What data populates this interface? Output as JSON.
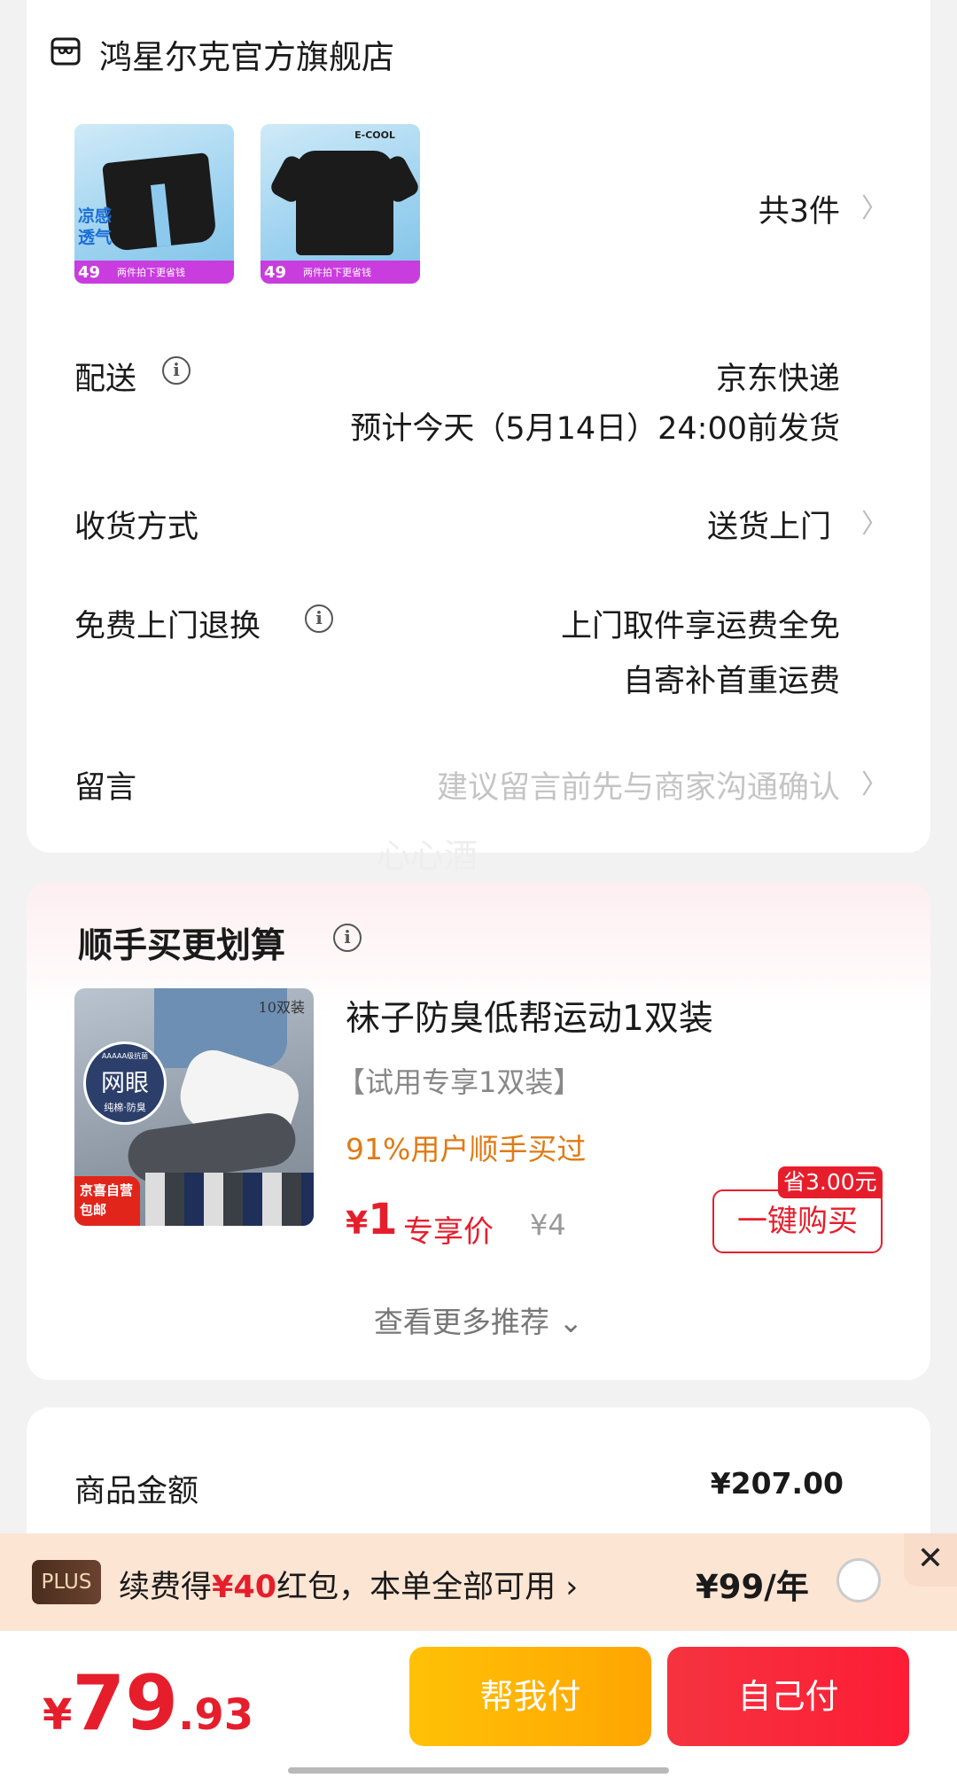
{
  "store": {
    "name": "鸿星尔克官方旗舰店",
    "item_count": "共3件",
    "thumbs": [
      {
        "cool_text": "凉感透气",
        "price": "49",
        "promo": "两件拍下更省钱"
      },
      {
        "brand": "E-COOL",
        "price": "49",
        "promo": "两件拍下更省钱"
      }
    ]
  },
  "delivery": {
    "label": "配送",
    "carrier": "京东快递",
    "eta": "预计今天（5月14日）24:00前发货"
  },
  "receive": {
    "label": "收货方式",
    "value": "送货上门"
  },
  "returns": {
    "label": "免费上门退换",
    "line1": "上门取件享运费全免",
    "line2": "自寄补首重运费"
  },
  "message": {
    "label": "留言",
    "placeholder": "建议留言前先与商家沟通确认"
  },
  "watermark": "心心酒",
  "bundle": {
    "title": "顺手买更划算",
    "product": {
      "title": "袜子防臭低帮运动1双装",
      "spec": "【试用专享1双装】",
      "social": "91%用户顺手买过",
      "currency": "¥",
      "price": "1",
      "price_tag": "专享价",
      "orig_price": "¥4",
      "save_badge": "省3.00元",
      "buy_label": "一键购买",
      "img_badge_main": "网眼",
      "img_badge_sub": "纯棉·防臭",
      "img_badge_top": "AAAAA级抗菌",
      "img_count": "10双装",
      "img_corner": "京喜自营包邮"
    },
    "see_more": "查看更多推荐"
  },
  "amount": {
    "label": "商品金额",
    "value": "¥207.00"
  },
  "plus": {
    "badge": "PLUS",
    "text_prefix": "续费得",
    "text_amount": "¥40",
    "text_suffix": "红包，本单全部可用",
    "price": "¥99/年"
  },
  "footer": {
    "currency": "¥",
    "total_int": "79",
    "total_dec": ".93",
    "help_pay": "帮我付",
    "self_pay": "自己付"
  },
  "colors": {
    "accent_red": "#e61e2c",
    "orange": "#e07a14",
    "help_yellow": "#ffb300"
  }
}
